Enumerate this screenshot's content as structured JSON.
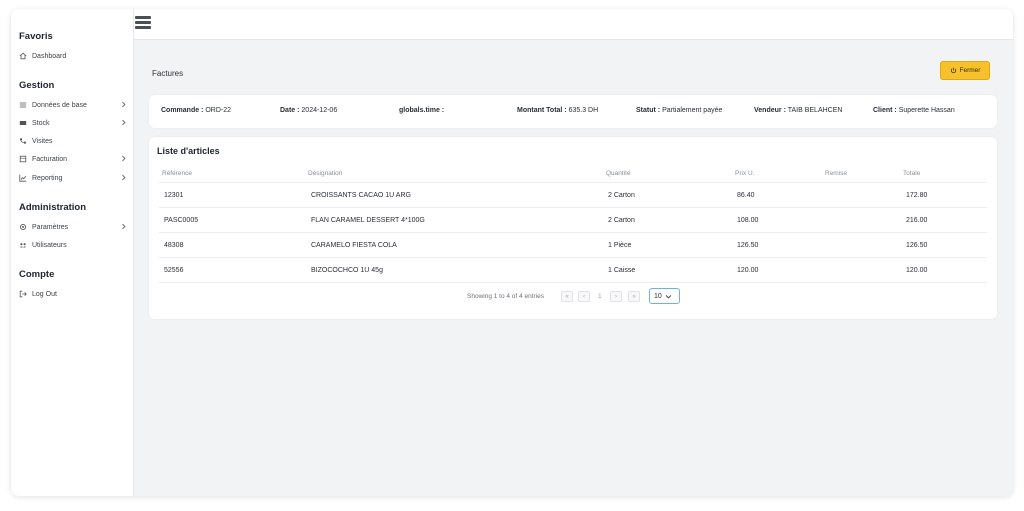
{
  "sidebar": {
    "favoris": {
      "title": "Favoris",
      "items": [
        {
          "label": "Dashboard",
          "icon": "home-icon"
        }
      ]
    },
    "gestion": {
      "title": "Gestion",
      "items": [
        {
          "label": "Données de base",
          "icon": "list-icon"
        },
        {
          "label": "Stock",
          "icon": "stock-icon"
        },
        {
          "label": "Visites",
          "icon": "route-icon"
        },
        {
          "label": "Facturation",
          "icon": "invoice-icon"
        },
        {
          "label": "Reporting",
          "icon": "chart-icon"
        }
      ]
    },
    "administration": {
      "title": "Administration",
      "items": [
        {
          "label": "Paramètres",
          "icon": "gear-icon"
        },
        {
          "label": "Utilisateurs",
          "icon": "users-icon"
        }
      ]
    },
    "compte": {
      "title": "Compte",
      "items": [
        {
          "label": "Log Out",
          "icon": "logout-icon"
        }
      ]
    }
  },
  "header": {
    "title": "Factures",
    "close_label": "Fermer"
  },
  "info": {
    "commande_label": "Commande :",
    "commande_value": "ORD-22",
    "date_label": "Date :",
    "date_value": "2024-12-06",
    "time_label": "globals.time :",
    "time_value": "",
    "montant_label": "Montant Total :",
    "montant_value": "635.3 DH",
    "statut_label": "Statut :",
    "statut_value": "Partialement payée",
    "vendeur_label": "Vendeur :",
    "vendeur_value": "TAIB BELAHCEN",
    "client_label": "Client :",
    "client_value": "Superette Hassan"
  },
  "articles": {
    "title": "Liste d'articles",
    "columns": [
      "Référence",
      "Désignation",
      "Quantité",
      "Prix U.",
      "Remise",
      "Totale"
    ],
    "rows": [
      {
        "ref": "12301",
        "designation": "CROISSANTS CACAO 1U ARG",
        "quantite": "2 Carton",
        "prix": "86.40",
        "remise": "",
        "totale": "172.80"
      },
      {
        "ref": "PASC0005",
        "designation": "FLAN CARAMEL DESSERT 4*100G",
        "quantite": "2 Carton",
        "prix": "108.00",
        "remise": "",
        "totale": "216.00"
      },
      {
        "ref": "48308",
        "designation": "CARAMELO FIESTA COLA",
        "quantite": "1 Pièce",
        "prix": "126.50",
        "remise": "",
        "totale": "126.50"
      },
      {
        "ref": "52556",
        "designation": "BIZOCOCHCO 1U 45g",
        "quantite": "1 Caisse",
        "prix": "120.00",
        "remise": "",
        "totale": "120.00"
      }
    ]
  },
  "pagination": {
    "summary": "Showing 1 to 4 of 4 entries",
    "first": "«",
    "prev": "‹",
    "page": "1",
    "next": "›",
    "last": "»",
    "page_size": "10"
  }
}
